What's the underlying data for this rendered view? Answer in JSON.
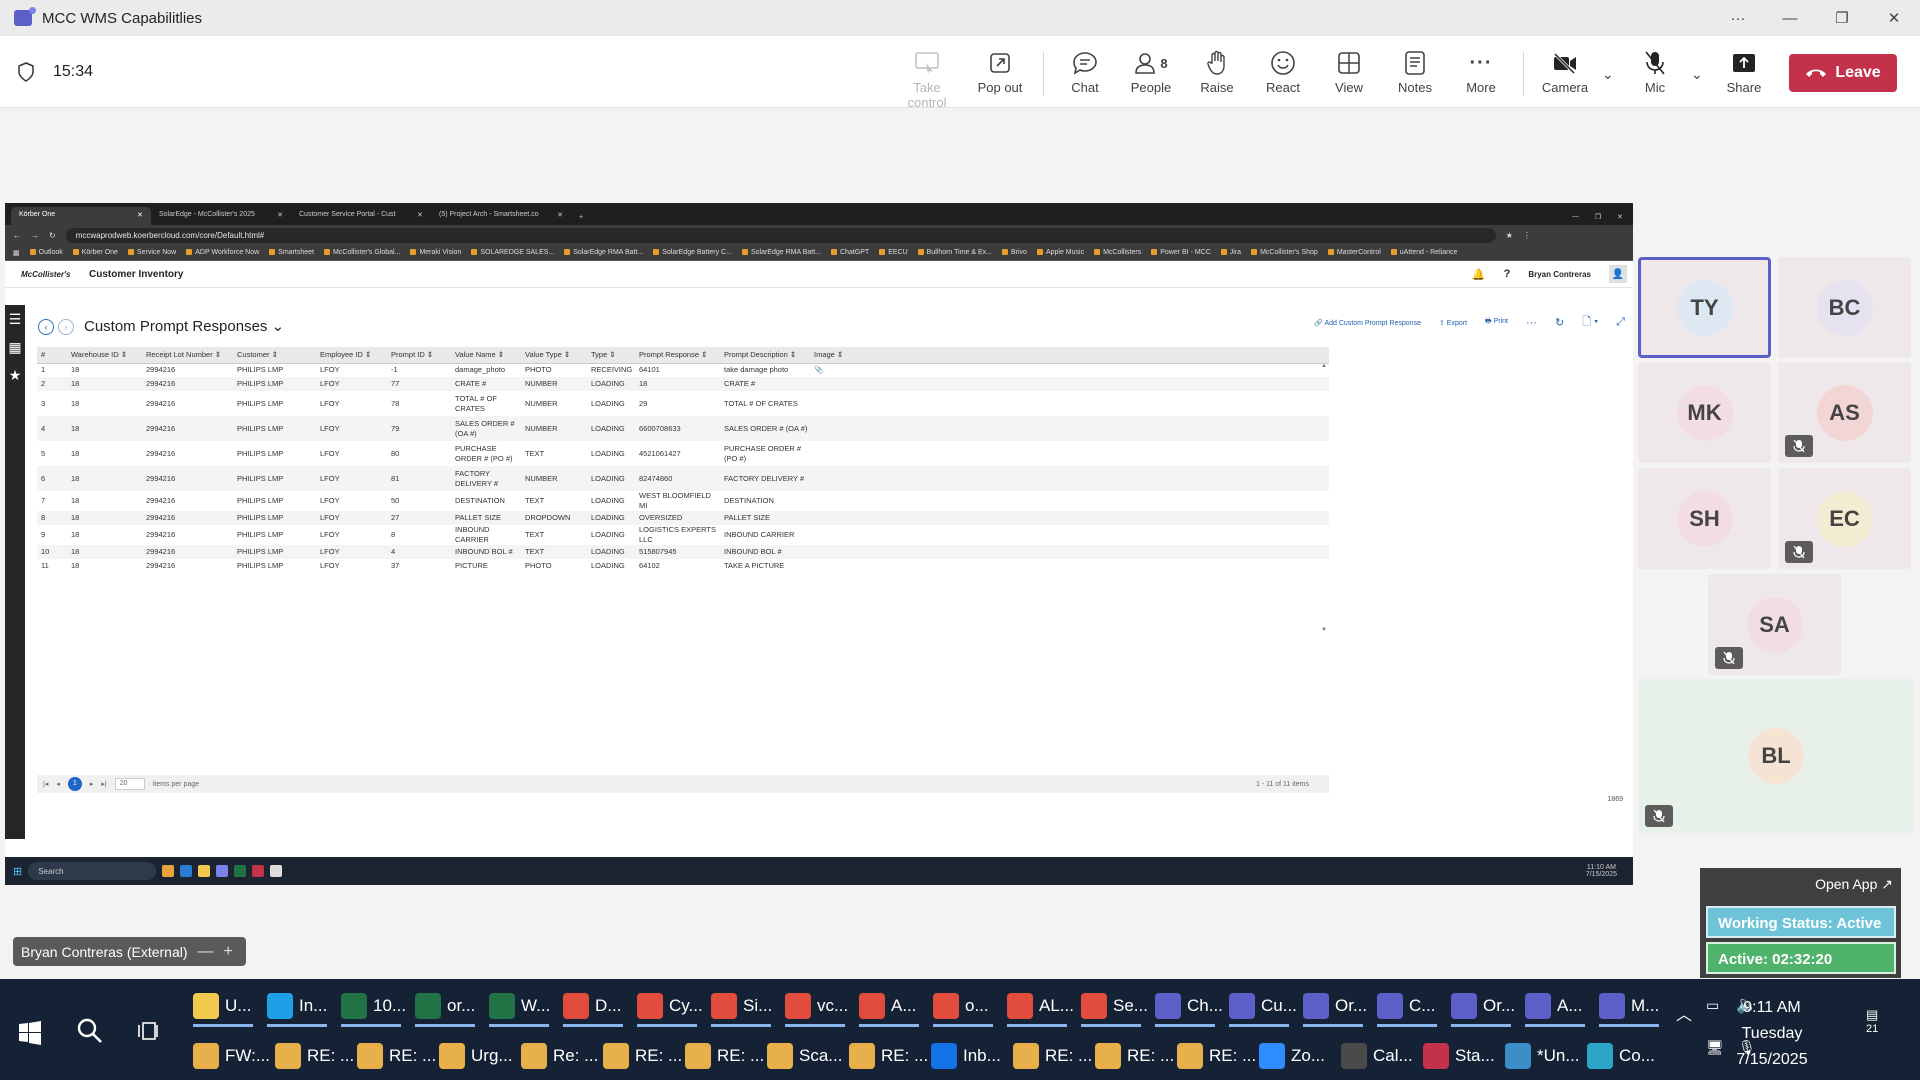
{
  "window": {
    "title": "MCC WMS Capabilitlies"
  },
  "meeting": {
    "timer": "15:34",
    "toolbar": {
      "take_control": "Take control",
      "pop_out": "Pop out",
      "chat": "Chat",
      "people": "People",
      "people_count": "8",
      "raise": "Raise",
      "react": "React",
      "view": "View",
      "notes": "Notes",
      "more": "More",
      "camera": "Camera",
      "mic": "Mic",
      "share": "Share",
      "leave": "Leave"
    },
    "participants": [
      {
        "initials": "TY",
        "color": "#dde8f2",
        "muted": false
      },
      {
        "initials": "BC",
        "color": "#e6e2f0",
        "muted": false
      },
      {
        "initials": "MK",
        "color": "#f2dde2",
        "muted": false
      },
      {
        "initials": "AS",
        "color": "#f2d6d6",
        "muted": true
      },
      {
        "initials": "SH",
        "color": "#f4dde2",
        "muted": false
      },
      {
        "initials": "EC",
        "color": "#f3ecd2",
        "muted": true
      },
      {
        "initials": "SA",
        "color": "#f2dde2",
        "muted": true
      },
      {
        "initials": "BL",
        "color": "#f7e3d4",
        "muted": true
      }
    ],
    "presenter": "Bryan Contreras (External)",
    "widget": {
      "open_app": "Open App ↗",
      "working_status": "Working Status: Active",
      "active": "Active: 02:32:20"
    }
  },
  "browser": {
    "tabs": [
      "Körber One",
      "SolarEdge - McCollister's 2025",
      "Customer Service Portal - Cust",
      "(5) Project Arch - Smartsheet.co"
    ],
    "url": "mccwaprodweb.koerbercloud.com/core/Default.html#",
    "bookmarks": [
      "Outlook",
      "Körber One",
      "Service Now",
      "ADP Workforce Now",
      "Smartsheet",
      "McCollister's Global...",
      "Meraki Vision",
      "SOLAREDGE SALES...",
      "SolarEdge RMA Batt...",
      "SolarEdge Battery C...",
      "SolarEdge RMA Batt...",
      "ChatGPT",
      "EECU",
      "Bullhorn Time & Ex...",
      "Brivo",
      "Apple Music",
      "McCollisters",
      "Power BI - MCC",
      "Jira",
      "McCollister's Shop",
      "MasterControl",
      "uAttend - Reliance"
    ]
  },
  "app": {
    "logo": "McCollister's",
    "title": "Customer Inventory",
    "user": "Bryan Contreras",
    "page_title": "Custom Prompt Responses",
    "actions": {
      "add": "Add Custom Prompt Response",
      "export": "Export",
      "print": "Print"
    },
    "columns": [
      "#",
      "Warehouse ID",
      "Receipt Lot Number",
      "Customer",
      "Employee ID",
      "Prompt ID",
      "Value Name",
      "Value Type",
      "Type",
      "Prompt Response",
      "Prompt Description",
      "Image"
    ],
    "rows": [
      [
        "1",
        "18",
        "2994216",
        "PHILIPS LMP",
        "LFOY",
        "-1",
        "damage_photo",
        "PHOTO",
        "RECEIVING",
        "64101",
        "take damage photo",
        "📎"
      ],
      [
        "2",
        "18",
        "2994216",
        "PHILIPS LMP",
        "LFOY",
        "77",
        "CRATE #",
        "NUMBER",
        "LOADING",
        "18",
        "CRATE #",
        ""
      ],
      [
        "3",
        "18",
        "2994216",
        "PHILIPS LMP",
        "LFOY",
        "78",
        "TOTAL # OF CRATES",
        "NUMBER",
        "LOADING",
        "29",
        "TOTAL # OF CRATES",
        ""
      ],
      [
        "4",
        "18",
        "2994216",
        "PHILIPS LMP",
        "LFOY",
        "79",
        "SALES ORDER # (OA #)",
        "NUMBER",
        "LOADING",
        "6600708633",
        "SALES ORDER # (OA #)",
        ""
      ],
      [
        "5",
        "18",
        "2994216",
        "PHILIPS LMP",
        "LFOY",
        "80",
        "PURCHASE ORDER # (PO #)",
        "TEXT",
        "LOADING",
        "4521061427",
        "PURCHASE ORDER # (PO #)",
        ""
      ],
      [
        "6",
        "18",
        "2994216",
        "PHILIPS LMP",
        "LFOY",
        "81",
        "FACTORY DELIVERY #",
        "NUMBER",
        "LOADING",
        "82474860",
        "FACTORY DELIVERY #",
        ""
      ],
      [
        "7",
        "18",
        "2994216",
        "PHILIPS LMP",
        "LFOY",
        "50",
        "DESTINATION",
        "TEXT",
        "LOADING",
        "WEST BLOOMFIELD MI",
        "DESTINATION",
        ""
      ],
      [
        "8",
        "18",
        "2994216",
        "PHILIPS LMP",
        "LFOY",
        "27",
        "PALLET SIZE",
        "DROPDOWN",
        "LOADING",
        "OVERSIZED",
        "PALLET SIZE",
        ""
      ],
      [
        "9",
        "18",
        "2994216",
        "PHILIPS LMP",
        "LFOY",
        "8",
        "INBOUND CARRIER",
        "TEXT",
        "LOADING",
        "LOGISTICS EXPERTS LLC",
        "INBOUND CARRIER",
        ""
      ],
      [
        "10",
        "18",
        "2994216",
        "PHILIPS LMP",
        "LFOY",
        "4",
        "INBOUND BOL #",
        "TEXT",
        "LOADING",
        "515807945",
        "INBOUND BOL #",
        ""
      ],
      [
        "11",
        "18",
        "2994216",
        "PHILIPS LMP",
        "LFOY",
        "37",
        "PICTURE",
        "PHOTO",
        "LOADING",
        "64102",
        "TAKE A PICTURE",
        ""
      ]
    ],
    "pager": {
      "current_page": "1",
      "page_size": "20",
      "items_per_page": "items per page",
      "count": "1 - 11 of 11 items"
    },
    "extra_number": "1869"
  },
  "remote_taskbar": {
    "search": "Search",
    "time": "11:10 AM",
    "date": "7/15/2025"
  },
  "taskbar": {
    "items_row1": [
      "U...",
      "In...",
      "10...",
      "or...",
      "W...",
      "D...",
      "Cy...",
      "Si...",
      "vc...",
      "A...",
      "o...",
      "AL...",
      "Se...",
      "Ch...",
      "Cu...",
      "Or...",
      "C...",
      "Or...",
      "A...",
      "M..."
    ],
    "items_row2": [
      "FW:...",
      "RE: ...",
      "RE: ...",
      "Urg...",
      "Re: ...",
      "RE: ...",
      "RE: ...",
      "Sca...",
      "RE: ...",
      "Inb...",
      "RE: ...",
      "RE: ...",
      "RE: ...",
      "Zo...",
      "Cal...",
      "Sta...",
      "*Un...",
      "Co..."
    ],
    "time": "9:11 AM",
    "day": "Tuesday",
    "date": "7/15/2025",
    "notifications": "21"
  }
}
